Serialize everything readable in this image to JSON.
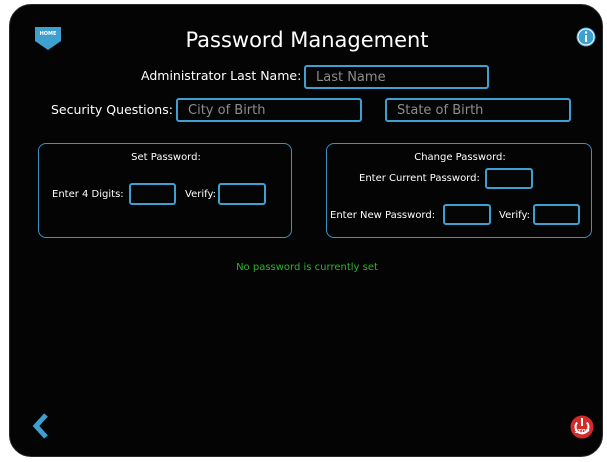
{
  "header": {
    "title": "Password Management",
    "home_label": "HOME",
    "info_icon": "info-icon"
  },
  "admin": {
    "label": "Administrator Last Name:",
    "placeholder": "Last Name"
  },
  "security": {
    "label": "Security Questions:",
    "q1_placeholder": "City of Birth",
    "q2_placeholder": "State of Birth"
  },
  "set_password": {
    "title": "Set Password:",
    "digits_label": "Enter 4 Digits:",
    "verify_label": "Verify:"
  },
  "change_password": {
    "title": "Change Password:",
    "current_label": "Enter Current Password:",
    "new_label": "Enter New  Password:",
    "verify_label": "Verify:"
  },
  "status": {
    "message": "No password is currently set",
    "color": "#2fb52f"
  },
  "footer": {
    "back_icon": "chevron-left-icon",
    "stop_label": "STOP"
  },
  "colors": {
    "accent": "#3ea0d0",
    "background": "#040404",
    "stop": "#d42a2a"
  }
}
